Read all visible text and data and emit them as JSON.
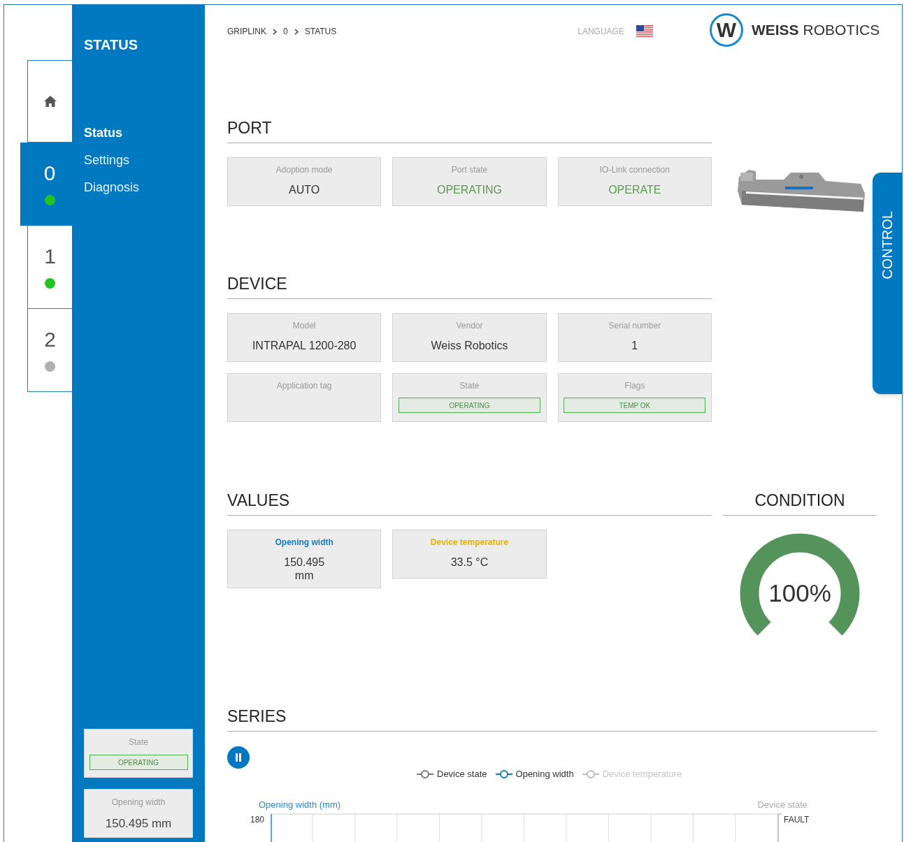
{
  "home_tab": {
    "selected": false
  },
  "port_tabs": [
    {
      "label": "0",
      "selected": true,
      "color": "#22c322"
    },
    {
      "label": "1",
      "selected": false,
      "color": "#22c322"
    },
    {
      "label": "2",
      "selected": false,
      "color": "#b0b0b0"
    }
  ],
  "sidebar": {
    "title": "STATUS",
    "items": [
      {
        "label": "Status",
        "selected": true
      },
      {
        "label": "Settings",
        "selected": false
      },
      {
        "label": "Diagnosis",
        "selected": false
      }
    ],
    "cards": [
      {
        "kind": "badge",
        "label": "State",
        "value": "OPERATING"
      },
      {
        "kind": "text",
        "label": "Opening width",
        "value": "150.495 mm"
      }
    ]
  },
  "breadcrumb": [
    "GRIPLINK",
    "0",
    "STATUS"
  ],
  "language_label": "LANGUAGE",
  "logo": {
    "mark": "W",
    "name": "**WEISS** ROBOTICS"
  },
  "port": {
    "title": "PORT",
    "cards": [
      {
        "kind": "text",
        "label": "Adoption mode",
        "value": "AUTO",
        "color": "#333333"
      },
      {
        "kind": "text",
        "label": "Port state",
        "value": "OPERATING",
        "color": "#5a9a50"
      },
      {
        "kind": "text",
        "label": "IO-Link connection",
        "value": "OPERATE",
        "color": "#5a9a50"
      }
    ]
  },
  "device": {
    "title": "DEVICE",
    "cards": [
      {
        "kind": "text",
        "label": "Model",
        "value": "INTRAPAL 1200-280"
      },
      {
        "kind": "text",
        "label": "Vendor",
        "value": "Weiss Robotics"
      },
      {
        "kind": "text",
        "label": "Serial number",
        "value": "1"
      },
      {
        "kind": "empty",
        "label": "Application tag"
      },
      {
        "kind": "badge",
        "label": "State",
        "value": "OPERATING"
      },
      {
        "kind": "badge",
        "label": "Flags",
        "value": "TEMP OK"
      }
    ]
  },
  "values": {
    "title": "VALUES",
    "cards": [
      {
        "label": "Opening width",
        "value": "150.495 mm",
        "color": "#0f7fc4"
      },
      {
        "label": "Device temperature",
        "value": "33.5 °C",
        "color": "#e6b400"
      }
    ]
  },
  "condition": {
    "title": "CONDITION",
    "reading": "100%"
  },
  "series": {
    "title": "SERIES",
    "legend": [
      {
        "label": "Device state",
        "enabled": true,
        "color": "#777777"
      },
      {
        "label": "Opening width",
        "enabled": true,
        "color": "#0f7fc4"
      },
      {
        "label": "Device temperature",
        "enabled": false,
        "color": "#bbbbbb"
      }
    ],
    "left_axis_title": "Opening width (mm)",
    "right_axis_title": "Device state",
    "left_tick": "180",
    "right_tick": "FAULT"
  },
  "control_tab": "CONTROL"
}
